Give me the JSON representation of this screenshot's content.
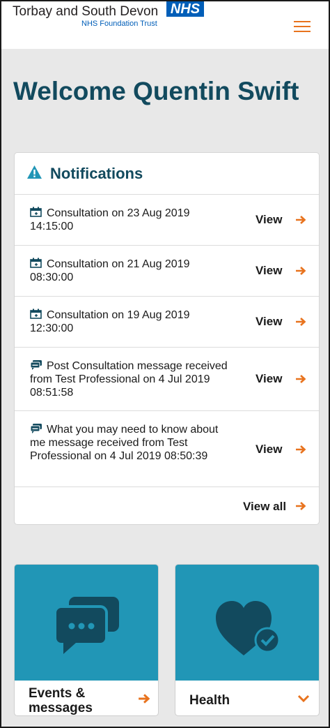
{
  "header": {
    "org_name": "Torbay and South Devon",
    "nhs_logo": "NHS",
    "trust_name": "NHS Foundation Trust",
    "menu_icon": "hamburger-menu-icon",
    "accent_color": "#e8731e",
    "nhs_blue": "#005eb8"
  },
  "welcome": "Welcome Quentin Swift",
  "notifications": {
    "title": "Notifications",
    "icon": "warning-icon",
    "items": [
      {
        "icon": "calendar-icon",
        "text": "Consultation on 23 Aug 2019 14:15:00",
        "action": "View"
      },
      {
        "icon": "calendar-icon",
        "text": "Consultation on 21 Aug 2019 08:30:00",
        "action": "View"
      },
      {
        "icon": "calendar-icon",
        "text": "Consultation on 19 Aug 2019 12:30:00",
        "action": "View"
      },
      {
        "icon": "message-icon",
        "text": "Post Consultation message received from Test Professional on 4 Jul 2019 08:51:58",
        "action": "View"
      },
      {
        "icon": "message-icon",
        "text": "What you may need to know about me message received from Test Professional on 4 Jul 2019 08:50:39",
        "action": "View"
      }
    ],
    "view_all": "View all"
  },
  "tiles": [
    {
      "label": "Events & messages",
      "icon": "chat-bubbles-icon",
      "indicator": "arrow-right-icon"
    },
    {
      "label": "Health",
      "icon": "heart-check-icon",
      "indicator": "chevron-down-icon"
    }
  ],
  "colors": {
    "heading": "#124a5e",
    "tile_bg": "#2196b6",
    "icon_dark": "#124a5e"
  }
}
